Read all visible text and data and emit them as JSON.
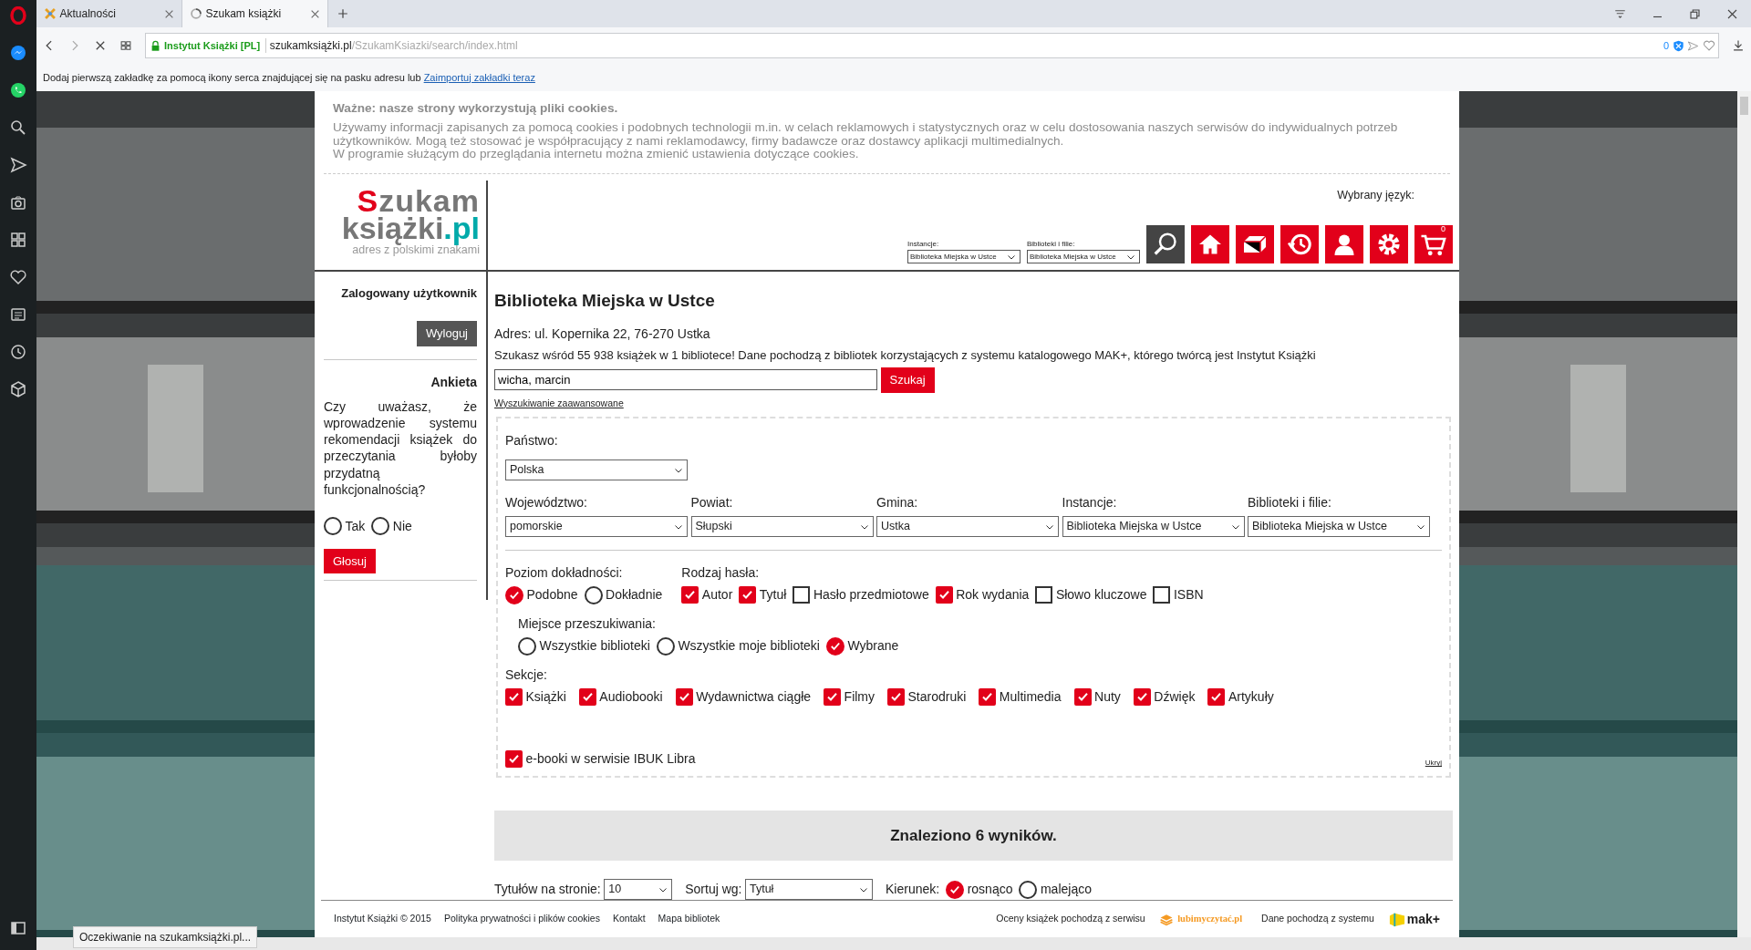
{
  "browser": {
    "tabs": [
      {
        "title": "Aktualności",
        "selected": false,
        "kind": "site"
      },
      {
        "title": "Szukam książki",
        "selected": true,
        "kind": "loading"
      }
    ],
    "address": {
      "security_label": "Instytut Książki [PL]",
      "host": "szukamksiążki.pl",
      "path": "/SzukamKsiazki/search/index.html",
      "blocked_count": "0"
    },
    "bookmark_hint": {
      "text": "Dodaj pierwszą zakładkę za pomocą ikony serca znajdującej się na pasku adresu lub",
      "link": "Zaimportuj zakładki teraz"
    },
    "status_text": "Oczekiwanie na szukamksiążki.pl..."
  },
  "cookies": {
    "title": "Ważne: nasze strony wykorzystują pliki cookies.",
    "paragraphs": [
      "Używamy informacji zapisanych za pomocą cookies i podobnych technologii m.in. w celach reklamowych i statystycznych oraz w celu dostosowania naszych serwisów do indywidualnych potrzeb użytkowników. Mogą też stosować je współpracujący z nami reklamodawcy, firmy badawcze oraz dostawcy aplikacji multimedialnych.",
      "W programie służącym do przeglądania internetu można zmienić ustawienia dotyczące cookies."
    ]
  },
  "header": {
    "logo": {
      "top": "Szukam",
      "bottom": "książki",
      "suffix": ".pl",
      "tagline": "adres z polskimi znakami"
    },
    "language_label": "Wybrany język:",
    "selects": [
      {
        "label": "Instancje:",
        "value": "Biblioteka Miejska w Ustce"
      },
      {
        "label": "Biblioteki i filie:",
        "value": "Biblioteka Miejska w Ustce"
      }
    ],
    "tools": [
      {
        "kind": "search"
      },
      {
        "kind": "home"
      },
      {
        "kind": "catalog"
      },
      {
        "kind": "history"
      },
      {
        "kind": "user"
      },
      {
        "kind": "settings"
      },
      {
        "kind": "cart",
        "badge": "0"
      }
    ]
  },
  "sidebar": {
    "user_title": "Zalogowany użytkownik",
    "logout": "Wyloguj",
    "poll_title": "Ankieta",
    "poll_question": "Czy uważasz, że wprowadzenie systemu rekomendacji książek do przeczytania byłoby przydatną funkcjonalnością?",
    "poll_options": [
      {
        "label": "Tak",
        "selected": false
      },
      {
        "label": "Nie",
        "selected": false
      }
    ],
    "vote": "Głosuj"
  },
  "main": {
    "title": "Biblioteka Miejska w Ustce",
    "address": "Adres: ul. Kopernika 22, 76-270 Ustka",
    "info": "Szukasz wśród 55 938 książek w 1 bibliotece! Dane pochodzą z bibliotek korzystających z systemu katalogowego MAK+, którego twórcą jest Instytut Książki",
    "query": "wicha, marcin",
    "search_button": "Szukaj",
    "advanced_link": "Wyszukiwanie zaawansowane",
    "filters": {
      "country": {
        "label": "Państwo:",
        "value": "Polska"
      },
      "selects": [
        {
          "label": "Województwo:",
          "value": "pomorskie"
        },
        {
          "label": "Powiat:",
          "value": "Słupski"
        },
        {
          "label": "Gmina:",
          "value": "Ustka"
        },
        {
          "label": "Instancje:",
          "value": "Biblioteka Miejska w Ustce"
        },
        {
          "label": "Biblioteki i filie:",
          "value": "Biblioteka Miejska w Ustce"
        }
      ],
      "precision": {
        "label": "Poziom dokładności:",
        "options": [
          {
            "label": "Podobne",
            "selected": true
          },
          {
            "label": "Dokładnie",
            "selected": false
          }
        ]
      },
      "keyword_types": {
        "label": "Rodzaj hasła:",
        "options": [
          {
            "label": "Autor",
            "checked": true
          },
          {
            "label": "Tytuł",
            "checked": true
          },
          {
            "label": "Hasło przedmiotowe",
            "checked": false
          },
          {
            "label": "Rok wydania",
            "checked": true
          },
          {
            "label": "Słowo kluczowe",
            "checked": false
          },
          {
            "label": "ISBN",
            "checked": false
          }
        ]
      },
      "scope": {
        "label": "Miejsce przeszukiwania:",
        "options": [
          {
            "label": "Wszystkie biblioteki",
            "selected": false
          },
          {
            "label": "Wszystkie moje biblioteki",
            "selected": false
          },
          {
            "label": "Wybrane",
            "selected": true
          }
        ]
      },
      "sections": {
        "label": "Sekcje:",
        "options": [
          {
            "label": "Książki",
            "checked": true
          },
          {
            "label": "Audiobooki",
            "checked": true
          },
          {
            "label": "Wydawnictwa ciągłe",
            "checked": true
          },
          {
            "label": "Filmy",
            "checked": true
          },
          {
            "label": "Starodruki",
            "checked": true
          },
          {
            "label": "Multimedia",
            "checked": true
          },
          {
            "label": "Nuty",
            "checked": true
          },
          {
            "label": "Dźwięk",
            "checked": true
          },
          {
            "label": "Artykuły",
            "checked": true
          }
        ]
      },
      "ebooks": {
        "label": "e-booki w serwisie IBUK Libra",
        "checked": true
      },
      "hide_link": "Ukryj"
    },
    "results_banner": "Znaleziono 6 wyników.",
    "per_page": {
      "label": "Tytułów na stronie:",
      "value": "10"
    },
    "sort": {
      "label": "Sortuj wg:",
      "value": "Tytuł"
    },
    "direction": {
      "label": "Kierunek:",
      "options": [
        {
          "label": "rosnąco",
          "selected": true
        },
        {
          "label": "malejąco",
          "selected": false
        }
      ]
    }
  },
  "footer": {
    "links": [
      "Instytut Książki © 2015",
      "Polityka prywatności i plików cookies",
      "Kontakt",
      "Mapa bibliotek"
    ],
    "ratings_text": "Oceny książek pochodzą z serwisu",
    "ratings_logo": "lubimyczytać.pl",
    "data_text": "Dane pochodzą z systemu",
    "data_logo": "mak+"
  }
}
